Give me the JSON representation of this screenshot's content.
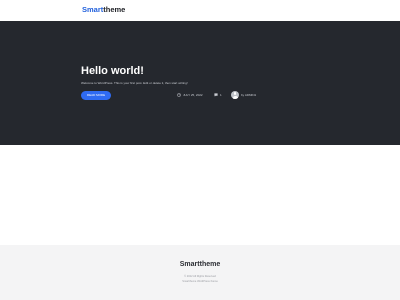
{
  "header": {
    "logo_part1": "Smart",
    "logo_part2": "theme"
  },
  "hero": {
    "title": "Hello world!",
    "excerpt": "Welcome to WordPress. This is your first post. Edit or delete it, then start writing!",
    "read_more": "READ MORE",
    "date": "JULY 25, 2022",
    "comments": "1",
    "author": "by ADMIN1"
  },
  "footer": {
    "logo": "Smarttheme",
    "copyright": "© 2022 All Rights Reserved",
    "credit": "Smarttheme WordPress theme"
  },
  "colors": {
    "brand_blue": "#1f5fdc",
    "hero_background": "#25282e",
    "button_blue": "#2f6bf2",
    "footer_background": "#f4f4f5"
  },
  "icons": {
    "date": "clock-icon",
    "comments": "comment-icon",
    "author": "avatar"
  }
}
